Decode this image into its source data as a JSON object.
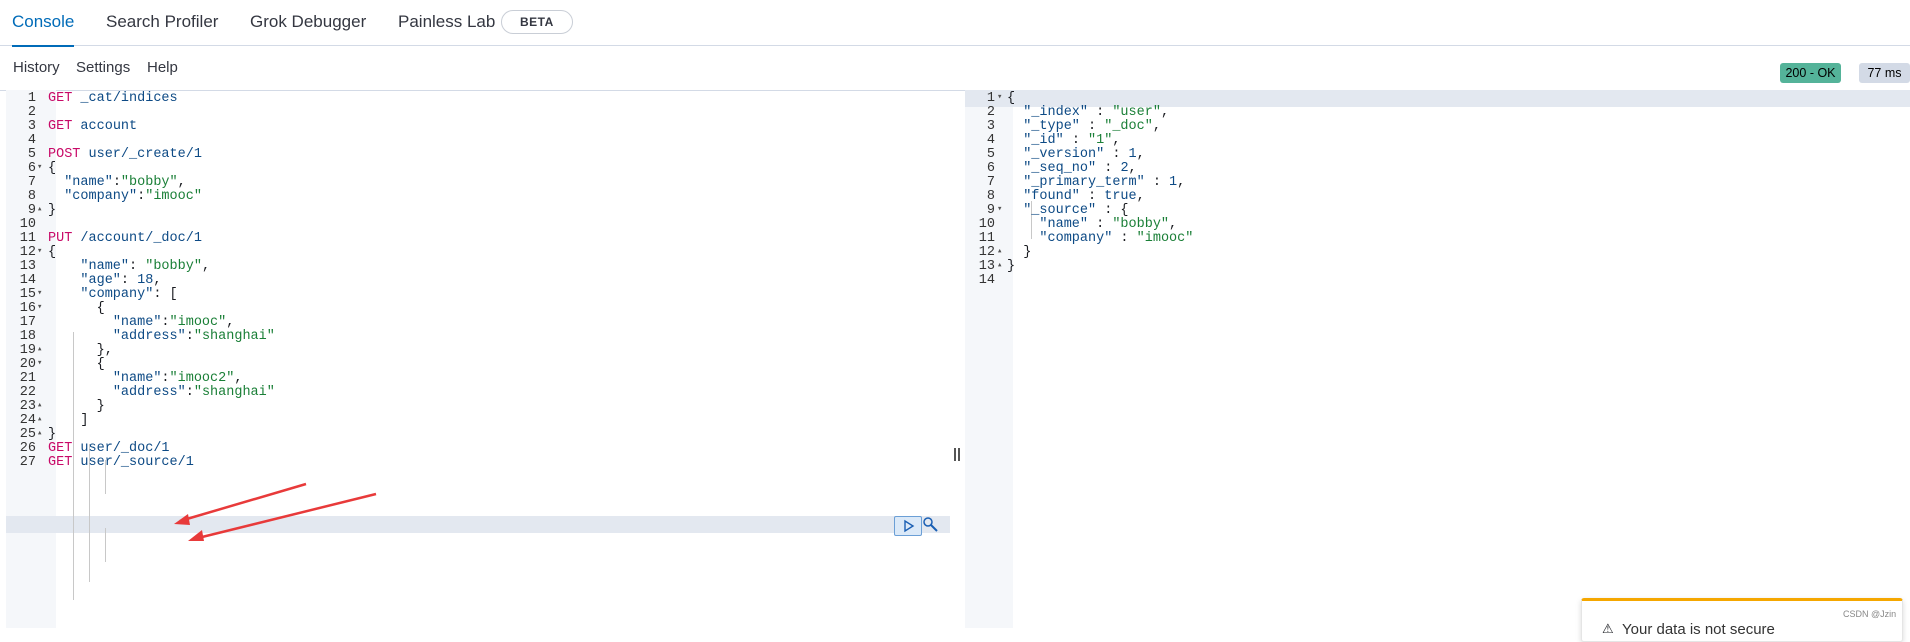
{
  "tabs": [
    {
      "label": "Console",
      "active": true
    },
    {
      "label": "Search Profiler",
      "active": false
    },
    {
      "label": "Grok Debugger",
      "active": false
    },
    {
      "label": "Painless Lab",
      "active": false
    }
  ],
  "beta_badge": "BETA",
  "toolbar": {
    "history": "History",
    "settings": "Settings",
    "help": "Help"
  },
  "status": {
    "code": "200 - OK",
    "time": "77 ms",
    "ok_color": "#54b399"
  },
  "request_lines": [
    [
      [
        "m",
        "GET"
      ],
      [
        "u",
        " _cat/indices"
      ]
    ],
    [],
    [
      [
        "m",
        "GET"
      ],
      [
        "u",
        " account"
      ]
    ],
    [],
    [
      [
        "m",
        "POST"
      ],
      [
        "u",
        " user/_create/1"
      ]
    ],
    [
      [
        "p",
        "{"
      ]
    ],
    [
      [
        "p",
        "  "
      ],
      [
        "k",
        "\"name\""
      ],
      [
        "p",
        ":"
      ],
      [
        "s",
        "\"bobby\""
      ],
      [
        "p",
        ","
      ]
    ],
    [
      [
        "p",
        "  "
      ],
      [
        "k",
        "\"company\""
      ],
      [
        "p",
        ":"
      ],
      [
        "s",
        "\"imooc\""
      ]
    ],
    [
      [
        "p",
        "}"
      ]
    ],
    [],
    [
      [
        "m",
        "PUT"
      ],
      [
        "u",
        " /account/_doc/1"
      ]
    ],
    [
      [
        "p",
        "{"
      ]
    ],
    [
      [
        "p",
        "    "
      ],
      [
        "k",
        "\"name\""
      ],
      [
        "p",
        ": "
      ],
      [
        "s",
        "\"bobby\""
      ],
      [
        "p",
        ","
      ]
    ],
    [
      [
        "p",
        "    "
      ],
      [
        "k",
        "\"age\""
      ],
      [
        "p",
        ": "
      ],
      [
        "n",
        "18"
      ],
      [
        "p",
        ","
      ]
    ],
    [
      [
        "p",
        "    "
      ],
      [
        "k",
        "\"company\""
      ],
      [
        "p",
        ": ["
      ]
    ],
    [
      [
        "p",
        "      {"
      ]
    ],
    [
      [
        "p",
        "        "
      ],
      [
        "k",
        "\"name\""
      ],
      [
        "p",
        ":"
      ],
      [
        "s",
        "\"imooc\""
      ],
      [
        "p",
        ","
      ]
    ],
    [
      [
        "p",
        "        "
      ],
      [
        "k",
        "\"address\""
      ],
      [
        "p",
        ":"
      ],
      [
        "s",
        "\"shanghai\""
      ]
    ],
    [
      [
        "p",
        "      },"
      ]
    ],
    [
      [
        "p",
        "      {"
      ]
    ],
    [
      [
        "p",
        "        "
      ],
      [
        "k",
        "\"name\""
      ],
      [
        "p",
        ":"
      ],
      [
        "s",
        "\"imooc2\""
      ],
      [
        "p",
        ","
      ]
    ],
    [
      [
        "p",
        "        "
      ],
      [
        "k",
        "\"address\""
      ],
      [
        "p",
        ":"
      ],
      [
        "s",
        "\"shanghai\""
      ]
    ],
    [
      [
        "p",
        "      }"
      ]
    ],
    [
      [
        "p",
        "    ]"
      ]
    ],
    [
      [
        "p",
        "}"
      ]
    ],
    [
      [
        "m",
        "GET"
      ],
      [
        "u",
        " user/_doc/1"
      ]
    ],
    [
      [
        "m",
        "GET"
      ],
      [
        "u",
        " user/_source/1"
      ]
    ]
  ],
  "request_folds": {
    "6": "down",
    "9": "up",
    "12": "down",
    "15": "down",
    "16": "down",
    "19": "up",
    "20": "down",
    "23": "up",
    "24": "up",
    "25": "up"
  },
  "response_lines": [
    [
      [
        "p",
        "{"
      ]
    ],
    [
      [
        "p",
        "  "
      ],
      [
        "k",
        "\"_index\""
      ],
      [
        "p",
        " : "
      ],
      [
        "s",
        "\"user\""
      ],
      [
        "p",
        ","
      ]
    ],
    [
      [
        "p",
        "  "
      ],
      [
        "k",
        "\"_type\""
      ],
      [
        "p",
        " : "
      ],
      [
        "s",
        "\"_doc\""
      ],
      [
        "p",
        ","
      ]
    ],
    [
      [
        "p",
        "  "
      ],
      [
        "k",
        "\"_id\""
      ],
      [
        "p",
        " : "
      ],
      [
        "s",
        "\"1\""
      ],
      [
        "p",
        ","
      ]
    ],
    [
      [
        "p",
        "  "
      ],
      [
        "k",
        "\"_version\""
      ],
      [
        "p",
        " : "
      ],
      [
        "n",
        "1"
      ],
      [
        "p",
        ","
      ]
    ],
    [
      [
        "p",
        "  "
      ],
      [
        "k",
        "\"_seq_no\""
      ],
      [
        "p",
        " : "
      ],
      [
        "n",
        "2"
      ],
      [
        "p",
        ","
      ]
    ],
    [
      [
        "p",
        "  "
      ],
      [
        "k",
        "\"_primary_term\""
      ],
      [
        "p",
        " : "
      ],
      [
        "n",
        "1"
      ],
      [
        "p",
        ","
      ]
    ],
    [
      [
        "p",
        "  "
      ],
      [
        "k",
        "\"found\""
      ],
      [
        "p",
        " : "
      ],
      [
        "n",
        "true"
      ],
      [
        "p",
        ","
      ]
    ],
    [
      [
        "p",
        "  "
      ],
      [
        "k",
        "\"_source\""
      ],
      [
        "p",
        " : {"
      ]
    ],
    [
      [
        "p",
        "    "
      ],
      [
        "k",
        "\"name\""
      ],
      [
        "p",
        " : "
      ],
      [
        "s",
        "\"bobby\""
      ],
      [
        "p",
        ","
      ]
    ],
    [
      [
        "p",
        "    "
      ],
      [
        "k",
        "\"company\""
      ],
      [
        "p",
        " : "
      ],
      [
        "s",
        "\"imooc\""
      ]
    ],
    [
      [
        "p",
        "  }"
      ]
    ],
    [
      [
        "p",
        "}"
      ]
    ],
    []
  ],
  "response_folds": {
    "1": "down",
    "9": "down",
    "12": "up",
    "13": "up"
  },
  "toast_text": "Your data is not secure",
  "watermark": "CSDN @Jzin"
}
